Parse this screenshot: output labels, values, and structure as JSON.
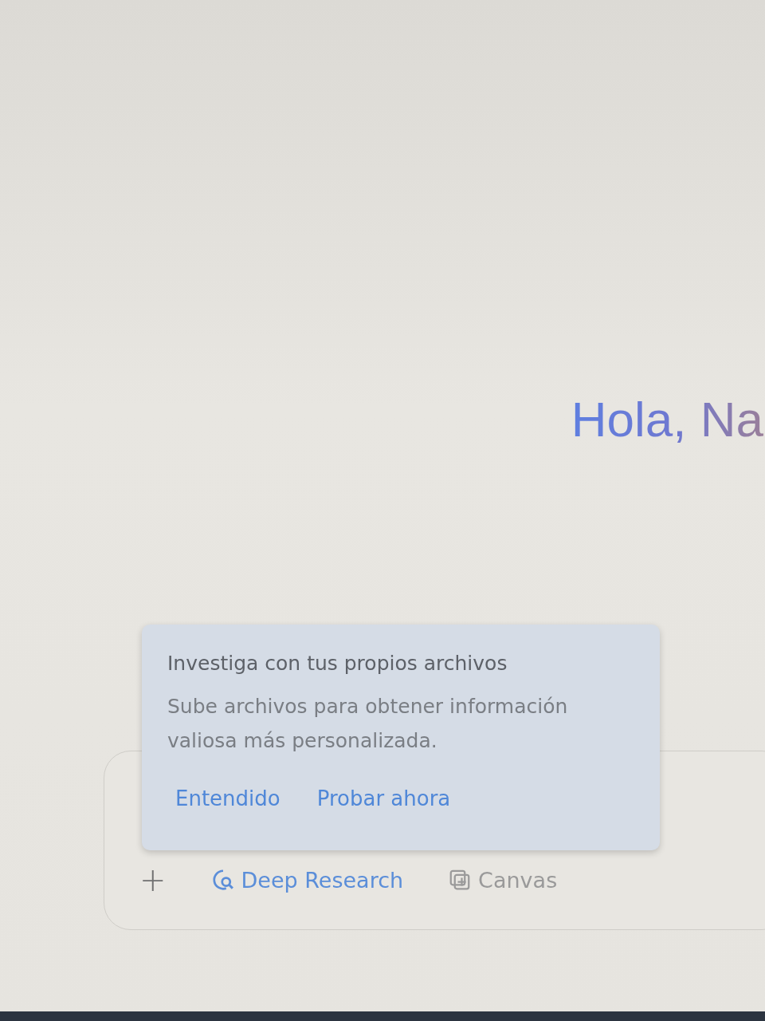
{
  "greeting": "Hola, Na",
  "tooltip": {
    "title": "Investiga con tus propios archivos",
    "body": "Sube archivos para obtener información valiosa más personalizada.",
    "actions": [
      "Entendido",
      "Probar ahora"
    ]
  },
  "composer": {
    "tools": [
      {
        "kind": "add",
        "label": "+"
      },
      {
        "kind": "deep-research",
        "label": "Deep Research",
        "selected": true
      },
      {
        "kind": "canvas",
        "label": "Canvas",
        "selected": false
      }
    ]
  }
}
